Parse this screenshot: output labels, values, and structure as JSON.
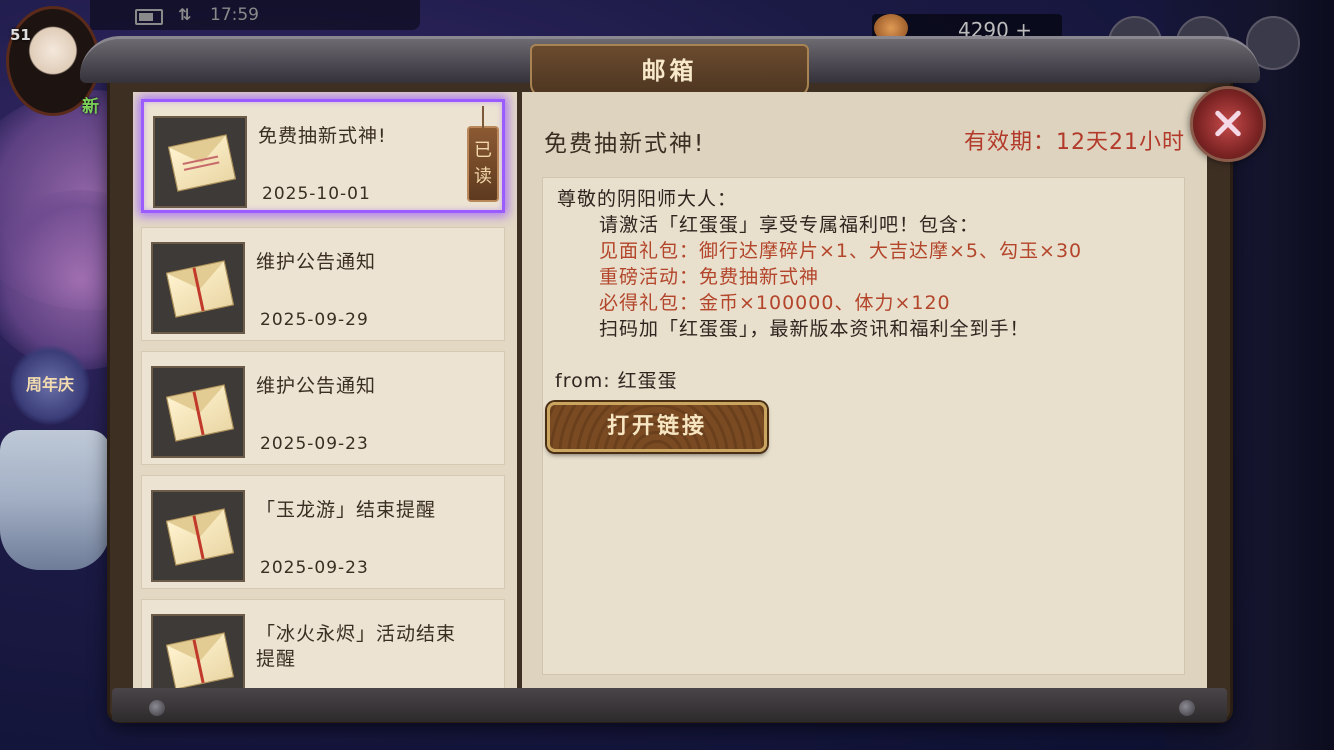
{
  "status_bar": {
    "time": "17:59",
    "level": "51"
  },
  "side": {
    "new_badge_left": "新",
    "new_badge_right": "新",
    "anniversary_label": "周年庆"
  },
  "currency": {
    "amount": "4290 +"
  },
  "window": {
    "title": "邮箱"
  },
  "mail_list": [
    {
      "title": "免费抽新式神!",
      "date": "2025-10-01",
      "selected": true,
      "read_tag": "已读",
      "opened": true
    },
    {
      "title": "维护公告通知",
      "date": "2025-09-29",
      "selected": false,
      "opened": false
    },
    {
      "title": "维护公告通知",
      "date": "2025-09-23",
      "selected": false,
      "opened": false
    },
    {
      "title": "「玉龙游」结束提醒",
      "date": "2025-09-23",
      "selected": false,
      "opened": false
    },
    {
      "title": "「冰火永烬」活动结束提醒",
      "date": "2025-09-23",
      "selected": false,
      "opened": false
    }
  ],
  "detail": {
    "title": "免费抽新式神!",
    "validity": "有效期：12天21小时",
    "greeting": "尊敬的阴阳师大人：",
    "intro": "请激活「红蛋蛋」享受专属福利吧！包含：",
    "gift_line_1": "见面礼包：御行达摩碎片×1、大吉达摩×5、勾玉×30",
    "gift_line_2": "重磅活动：免费抽新式神",
    "gift_line_3": "必得礼包：金币×100000、体力×120",
    "scan_line": "扫码加「红蛋蛋」，最新版本资讯和福利全到手！",
    "from": "from: 红蛋蛋",
    "open_link_label": "打开链接"
  },
  "colors": {
    "accent_red": "#b33a2a",
    "selection_purple": "#9b5cff",
    "panel_bg": "#ddd3bf"
  }
}
